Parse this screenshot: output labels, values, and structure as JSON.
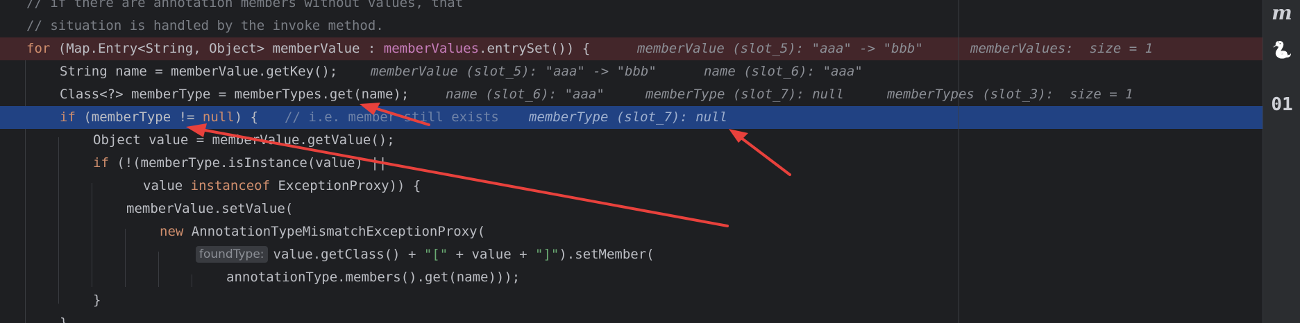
{
  "editor": {
    "lines": {
      "l0": "// if there are annotation members without values, that",
      "l1": "// situation is handled by the invoke method.",
      "l2": {
        "kw_for": "for",
        "a": " (Map.Entry<String, Object> memberValue : ",
        "field": "memberValues",
        "b": ".entrySet()) {",
        "inline1": "memberValue (slot_5): \"aaa\" -> \"bbb\"",
        "inline2": "memberValues:  size = 1"
      },
      "l3": {
        "code": "String name = memberValue.getKey();",
        "inline1": "memberValue (slot_5): \"aaa\" -> \"bbb\"",
        "inline2": "name (slot_6): \"aaa\""
      },
      "l4": {
        "code": "Class<?> memberType = memberTypes.get(name);",
        "inline1": "name (slot_6): \"aaa\"",
        "inline2": "memberType (slot_7): null",
        "inline3": "memberTypes (slot_3):  size = 1"
      },
      "l5": {
        "kw_if": "if",
        "a": " (memberType != ",
        "kw_null": "null",
        "b": ") {",
        "comment": "// i.e. member still exists",
        "inline1": "memberType (slot_7): null"
      },
      "l6": "Object value = memberValue.getValue();",
      "l7": {
        "kw_if": "if",
        "a": " (!(memberType.isInstance(value) ||"
      },
      "l8": {
        "a": "value ",
        "kw_instanceof": "instanceof",
        "b": " ExceptionProxy)) {"
      },
      "l9": "memberValue.setValue(",
      "l10": {
        "kw_new": "new",
        "a": " AnnotationTypeMismatchExceptionProxy("
      },
      "l11": {
        "hint": "foundType:",
        "a": "value.getClass() + ",
        "s1": "\"[\"",
        "b": " + value + ",
        "s2": "\"]\"",
        "c": ").setMember("
      },
      "l12": "annotationType.members().get(name)));",
      "l13": "}",
      "l14": "}"
    }
  },
  "rightbar": {
    "icon1_glyph": "m",
    "icon2_glyph": "🐍",
    "icon3_glyph": "01"
  },
  "colors": {
    "background": "#1e1f22",
    "breakpoint_line": "#43262a",
    "current_line": "#214283",
    "keyword": "#cf8e6d",
    "field": "#c77dbb",
    "string": "#6aab73",
    "annotation_arrow": "#e8413c"
  }
}
